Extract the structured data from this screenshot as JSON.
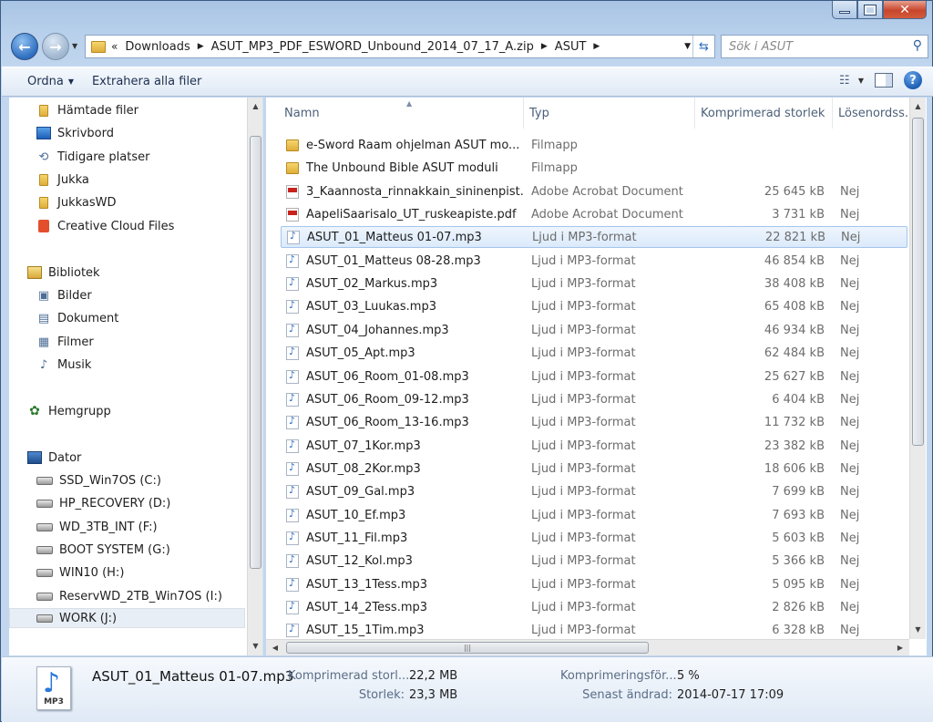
{
  "window": {
    "close_glyph": "✕"
  },
  "nav": {
    "breadcrumb": [
      "Downloads",
      "ASUT_MP3_PDF_ESWORD_Unbound_2014_07_17_A.zip",
      "ASUT"
    ],
    "overflow": "«",
    "search_placeholder": "Sök i ASUT"
  },
  "toolbar": {
    "organize": "Ordna",
    "extract_all": "Extrahera alla filer"
  },
  "sidebar": {
    "favorites": [
      "Hämtade filer",
      "Skrivbord",
      "Tidigare platser",
      "Jukka",
      "JukkasWD",
      "Creative Cloud Files"
    ],
    "library": "Bibliotek",
    "library_items": [
      "Bilder",
      "Dokument",
      "Filmer",
      "Musik"
    ],
    "homegroup": "Hemgrupp",
    "computer": "Dator",
    "drives": [
      "SSD_Win7OS (C:)",
      "HP_RECOVERY (D:)",
      "WD_3TB_INT (F:)",
      "BOOT SYSTEM (G:)",
      "WIN10 (H:)",
      "ReservWD_2TB_Win7OS (I:)",
      "WORK (J:)"
    ],
    "selected_drive": "WORK (J:)"
  },
  "columns": {
    "name": "Namn",
    "type": "Typ",
    "compressed": "Komprimerad storlek",
    "password": "Lösenordss..."
  },
  "files": [
    {
      "name": "e-Sword Raam ohjelman ASUT mo...",
      "type": "Filmapp",
      "size": "",
      "pw": "",
      "icon": "folder"
    },
    {
      "name": "The Unbound Bible ASUT moduli",
      "type": "Filmapp",
      "size": "",
      "pw": "",
      "icon": "folder"
    },
    {
      "name": "3_Kaannosta_rinnakkain_sininenpist...",
      "type": "Adobe Acrobat Document",
      "size": "25 645 kB",
      "pw": "Nej",
      "icon": "pdf"
    },
    {
      "name": "AapeliSaarisalo_UT_ruskeapiste.pdf",
      "type": "Adobe Acrobat Document",
      "size": "3 731 kB",
      "pw": "Nej",
      "icon": "pdf"
    },
    {
      "name": "ASUT_01_Matteus 01-07.mp3",
      "type": "Ljud i MP3-format",
      "size": "22 821 kB",
      "pw": "Nej",
      "icon": "mp3",
      "selected": true
    },
    {
      "name": "ASUT_01_Matteus 08-28.mp3",
      "type": "Ljud i MP3-format",
      "size": "46 854 kB",
      "pw": "Nej",
      "icon": "mp3"
    },
    {
      "name": "ASUT_02_Markus.mp3",
      "type": "Ljud i MP3-format",
      "size": "38 408 kB",
      "pw": "Nej",
      "icon": "mp3"
    },
    {
      "name": "ASUT_03_Luukas.mp3",
      "type": "Ljud i MP3-format",
      "size": "65 408 kB",
      "pw": "Nej",
      "icon": "mp3"
    },
    {
      "name": "ASUT_04_Johannes.mp3",
      "type": "Ljud i MP3-format",
      "size": "46 934 kB",
      "pw": "Nej",
      "icon": "mp3"
    },
    {
      "name": "ASUT_05_Apt.mp3",
      "type": "Ljud i MP3-format",
      "size": "62 484 kB",
      "pw": "Nej",
      "icon": "mp3"
    },
    {
      "name": "ASUT_06_Room_01-08.mp3",
      "type": "Ljud i MP3-format",
      "size": "25 627 kB",
      "pw": "Nej",
      "icon": "mp3"
    },
    {
      "name": "ASUT_06_Room_09-12.mp3",
      "type": "Ljud i MP3-format",
      "size": "6 404 kB",
      "pw": "Nej",
      "icon": "mp3"
    },
    {
      "name": "ASUT_06_Room_13-16.mp3",
      "type": "Ljud i MP3-format",
      "size": "11 732 kB",
      "pw": "Nej",
      "icon": "mp3"
    },
    {
      "name": "ASUT_07_1Kor.mp3",
      "type": "Ljud i MP3-format",
      "size": "23 382 kB",
      "pw": "Nej",
      "icon": "mp3"
    },
    {
      "name": "ASUT_08_2Kor.mp3",
      "type": "Ljud i MP3-format",
      "size": "18 606 kB",
      "pw": "Nej",
      "icon": "mp3"
    },
    {
      "name": "ASUT_09_Gal.mp3",
      "type": "Ljud i MP3-format",
      "size": "7 699 kB",
      "pw": "Nej",
      "icon": "mp3"
    },
    {
      "name": "ASUT_10_Ef.mp3",
      "type": "Ljud i MP3-format",
      "size": "7 693 kB",
      "pw": "Nej",
      "icon": "mp3"
    },
    {
      "name": "ASUT_11_Fil.mp3",
      "type": "Ljud i MP3-format",
      "size": "5 603 kB",
      "pw": "Nej",
      "icon": "mp3"
    },
    {
      "name": "ASUT_12_Kol.mp3",
      "type": "Ljud i MP3-format",
      "size": "5 366 kB",
      "pw": "Nej",
      "icon": "mp3"
    },
    {
      "name": "ASUT_13_1Tess.mp3",
      "type": "Ljud i MP3-format",
      "size": "5 095 kB",
      "pw": "Nej",
      "icon": "mp3"
    },
    {
      "name": "ASUT_14_2Tess.mp3",
      "type": "Ljud i MP3-format",
      "size": "2 826 kB",
      "pw": "Nej",
      "icon": "mp3"
    },
    {
      "name": "ASUT_15_1Tim.mp3",
      "type": "Ljud i MP3-format",
      "size": "6 328 kB",
      "pw": "Nej",
      "icon": "mp3"
    }
  ],
  "details": {
    "filename": "ASUT_01_Matteus 01-07.mp3",
    "icon_tag": "MP3",
    "compressed_label": "Komprimerad storl...",
    "compressed_value": "22,2 MB",
    "size_label": "Storlek:",
    "size_value": "23,3 MB",
    "ratio_label": "Komprimeringsför...",
    "ratio_value": "5 %",
    "modified_label": "Senast ändrad:",
    "modified_value": "2014-07-17 17:09"
  },
  "colors": {
    "selection_border": "#a5c5ed",
    "frame": "#b9d1ec"
  }
}
